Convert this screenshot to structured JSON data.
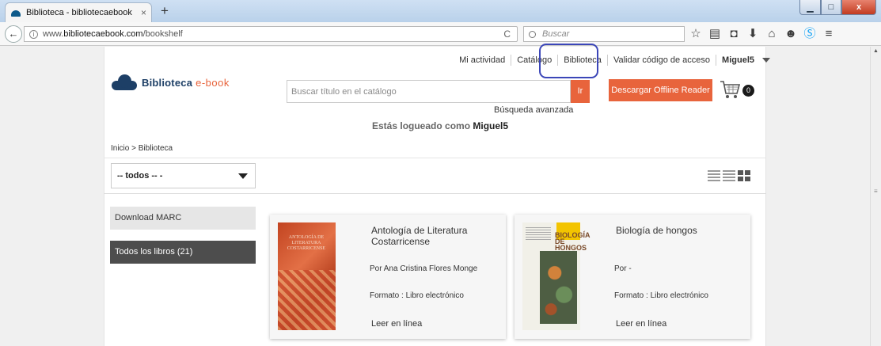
{
  "browser": {
    "tab_title": "Biblioteca - bibliotecaebook",
    "tab_close": "×",
    "new_tab": "+",
    "url_prefix": "www.",
    "url_host": "bibliotecaebook.com",
    "url_path": "/bookshelf",
    "reload": "C",
    "search_placeholder": "Buscar",
    "window_buttons": {
      "minimize": "▁",
      "maximize": "□",
      "close": "x"
    },
    "toolbar_icons": [
      "star-icon",
      "reading-list-icon",
      "pocket-icon",
      "download-icon",
      "home-icon",
      "chat-icon",
      "skype-icon",
      "menu-icon"
    ]
  },
  "header": {
    "nav": [
      {
        "label": "Mi actividad"
      },
      {
        "label": "Catálogo"
      },
      {
        "label": "Biblioteca"
      },
      {
        "label": "Validar código de acceso"
      }
    ],
    "user": "Miguel5",
    "logo_bold": "Biblioteca",
    "logo_light": "e-book",
    "search_placeholder": "Buscar título en el catálogo",
    "go_button": "Ir",
    "advanced_search": "Búsqueda avanzada",
    "logged_prefix": "Estás logueado como",
    "logged_user": "Miguel5",
    "offline_button": "Descargar Offline Reader",
    "cart_count": "0"
  },
  "breadcrumb": "Inicio > Biblioteca",
  "filter": {
    "selected": "-- todos -- -"
  },
  "sidebar": {
    "items": [
      {
        "label": "Download MARC"
      },
      {
        "label": "Todos los libros (21)"
      }
    ]
  },
  "books": [
    {
      "title": "Antología de Literatura Costarricense",
      "author": "Por Ana Cristina Flores Monge",
      "format": "Formato : Libro electrónico",
      "read": "Leer en línea",
      "cover_text": "ANTOLOGÍA DE LITERATURA COSTARRICENSE"
    },
    {
      "title": "Biología de hongos",
      "author": "Por -",
      "format": "Formato : Libro electrónico",
      "read": "Leer en línea",
      "cover_text": "BIOLOGÍA DE HONGOS"
    }
  ],
  "colors": {
    "accent": "#e8643c",
    "brand": "#1d3f66",
    "highlight": "#3b46b8"
  }
}
